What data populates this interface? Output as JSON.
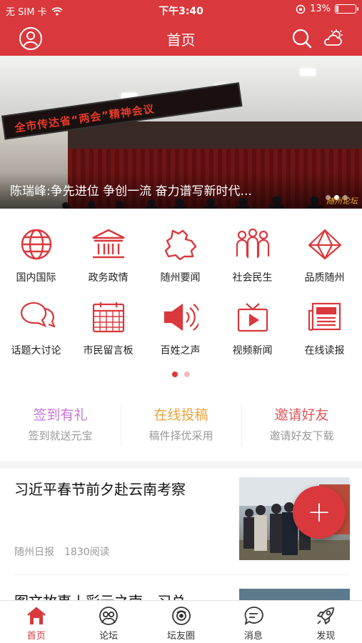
{
  "status": {
    "carrier": "无 SIM 卡",
    "time": "下午3:40",
    "battery": "13%",
    "battery_level": 0.13
  },
  "header": {
    "title": "首页"
  },
  "banner": {
    "led_text": "全市传达省“两会”精神会议",
    "caption": "陈瑞峰:争先进位 争创一流 奋力谱写新时代...",
    "watermark": "随州论坛",
    "page_count": 3,
    "active_page": 2
  },
  "grid": {
    "items": [
      {
        "label": "国内国际",
        "icon": "globe-icon"
      },
      {
        "label": "政务政情",
        "icon": "government-building-icon"
      },
      {
        "label": "随州要闻",
        "icon": "map-region-icon"
      },
      {
        "label": "社会民生",
        "icon": "people-group-icon"
      },
      {
        "label": "品质随州",
        "icon": "diamond-icon"
      },
      {
        "label": "话题大讨论",
        "icon": "chat-bubbles-icon"
      },
      {
        "label": "市民留言板",
        "icon": "calendar-board-icon"
      },
      {
        "label": "百姓之声",
        "icon": "megaphone-icon"
      },
      {
        "label": "视频新闻",
        "icon": "tv-play-icon"
      },
      {
        "label": "在线读报",
        "icon": "newspaper-icon"
      }
    ],
    "pages": 2,
    "active_page": 1
  },
  "quick": [
    {
      "title": "签到有礼",
      "sub": "签到就送元宝",
      "color": "#c775d8"
    },
    {
      "title": "在线投稿",
      "sub": "稿件择优采用",
      "color": "#e8a23a"
    },
    {
      "title": "邀请好友",
      "sub": "邀请好友下载",
      "color": "#e0565a"
    }
  ],
  "news": [
    {
      "title": "习近平春节前夕赴云南考察",
      "source": "随州日报",
      "reads": "1830阅读"
    },
    {
      "title": "图文故事丨彩云之南，习总"
    }
  ],
  "fab": {
    "label": "+"
  },
  "tabs": [
    {
      "label": "首页",
      "icon": "home-icon",
      "active": true
    },
    {
      "label": "论坛",
      "icon": "forum-icon",
      "active": false
    },
    {
      "label": "坛友圈",
      "icon": "circle-eye-icon",
      "active": false
    },
    {
      "label": "消息",
      "icon": "message-icon",
      "active": false
    },
    {
      "label": "发现",
      "icon": "rocket-icon",
      "active": false
    }
  ],
  "colors": {
    "brand": "#d9383c",
    "icon": "#d9383c"
  }
}
